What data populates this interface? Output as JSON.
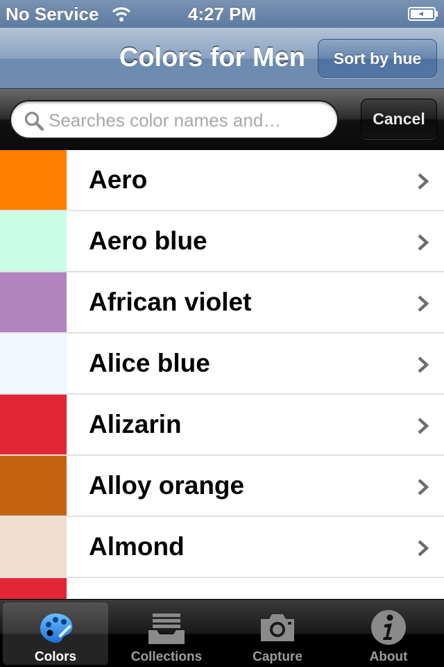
{
  "status_bar": {
    "carrier": "No Service",
    "time": "4:27 PM"
  },
  "nav": {
    "title": "Colors for Men",
    "sort_button": "Sort by hue"
  },
  "search": {
    "placeholder": "Searches color names and…",
    "value": "",
    "cancel_label": "Cancel"
  },
  "colors": [
    {
      "name": "Aero",
      "swatch": "#ff7f00"
    },
    {
      "name": "Aero blue",
      "swatch": "#c9ffe5"
    },
    {
      "name": "African violet",
      "swatch": "#b284be"
    },
    {
      "name": "Alice blue",
      "swatch": "#f0f8ff"
    },
    {
      "name": "Alizarin",
      "swatch": "#e32636"
    },
    {
      "name": "Alloy orange",
      "swatch": "#c46210"
    },
    {
      "name": "Almond",
      "swatch": "#efdecd"
    },
    {
      "name": "",
      "swatch": "#e32636"
    }
  ],
  "tabs": [
    {
      "label": "Colors",
      "icon": "palette-icon",
      "active": true
    },
    {
      "label": "Collections",
      "icon": "inbox-tray-icon",
      "active": false
    },
    {
      "label": "Capture",
      "icon": "camera-icon",
      "active": false
    },
    {
      "label": "About",
      "icon": "info-icon",
      "active": false
    }
  ]
}
